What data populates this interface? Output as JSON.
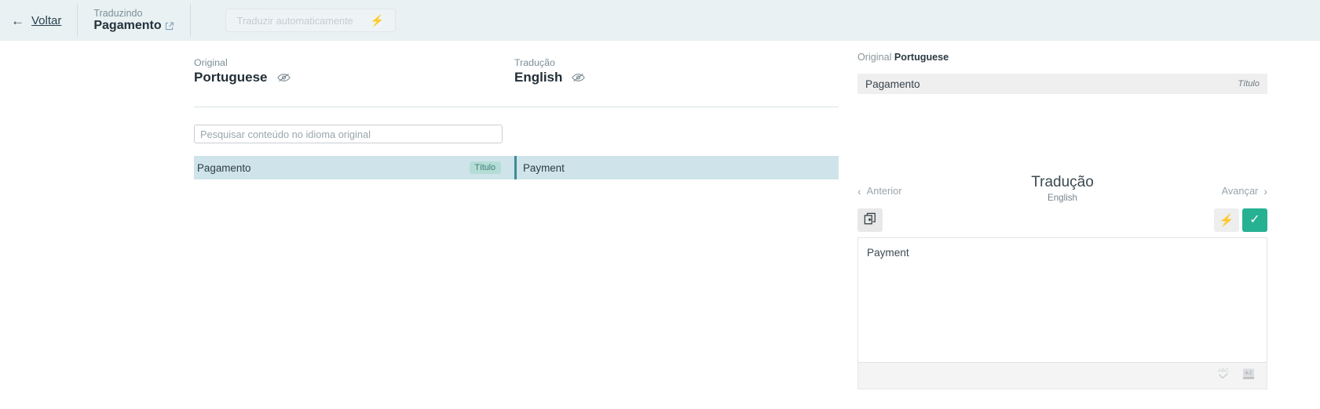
{
  "topbar": {
    "back_label": "Voltar",
    "back_arrow_icon": "arrow-left-icon",
    "translating_label": "Traduzindo",
    "translating_value": "Pagamento",
    "external_link_icon": "external-link-icon",
    "auto_translate_label": "Traduzir automaticamente",
    "auto_translate_icon": "lightning-bolt-icon"
  },
  "left_panel": {
    "original": {
      "caption": "Original",
      "language": "Portuguese",
      "visibility_icon": "eye-off-icon"
    },
    "translation": {
      "caption": "Tradução",
      "language": "English",
      "visibility_icon": "eye-off-icon"
    },
    "search": {
      "placeholder": "Pesquisar conteúdo no idioma original",
      "value": ""
    },
    "segments": [
      {
        "source": "Pagamento",
        "badge": "Título",
        "target": "Payment"
      }
    ]
  },
  "right_panel": {
    "original_caption": "Original",
    "original_language": "Portuguese",
    "original_value": "Pagamento",
    "original_field_tag": "Título",
    "nav": {
      "prev_label": "Anterior",
      "prev_icon": "chevron-left-icon",
      "next_label": "Avançar",
      "next_icon": "chevron-right-icon"
    },
    "title": "Tradução",
    "subtitle": "English",
    "toolbar": {
      "copy_icon": "copy-add-icon",
      "auto_icon": "lightning-bolt-icon",
      "confirm_icon": "check-icon"
    },
    "editor_value": "Payment",
    "footer": {
      "spellcheck_icon": "abc-spellcheck-icon",
      "dictionary_icon": "dictionary-book-icon"
    }
  },
  "colors": {
    "topbar_bg": "#e9f1f3",
    "row_highlight": "#cfe4ea",
    "badge_bg": "#b4ddd6",
    "badge_text": "#3c7b72",
    "accent_green": "#27b193",
    "divider_teal": "#3d8a9b"
  }
}
